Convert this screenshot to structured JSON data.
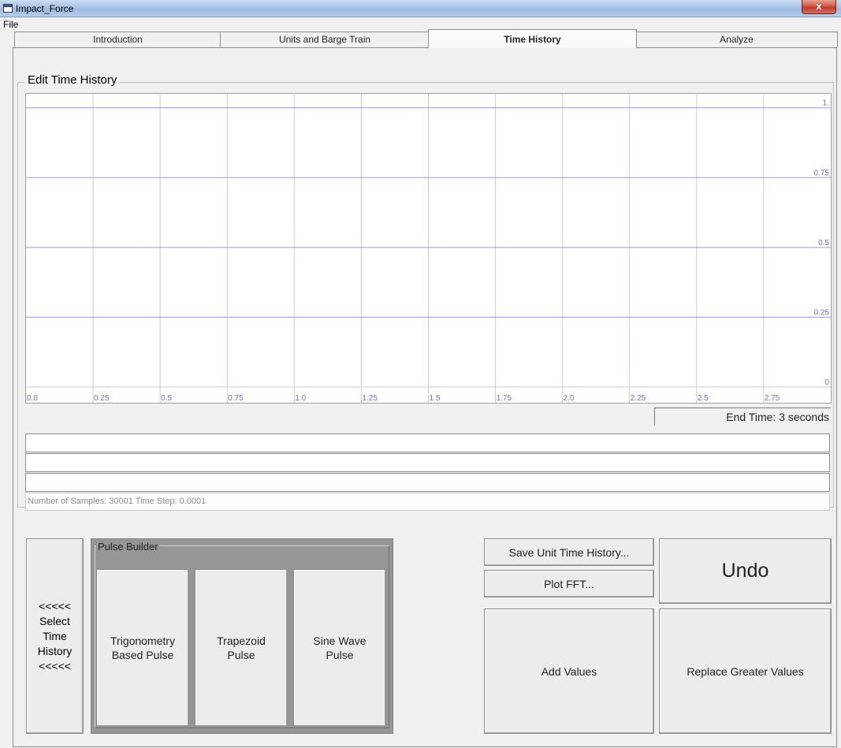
{
  "window": {
    "title": "Impact_Force",
    "close_glyph": "x",
    "app_icon": "window-icon"
  },
  "menu": {
    "file": "File"
  },
  "tabs": [
    {
      "label": "Introduction",
      "active": false
    },
    {
      "label": "Units and Barge Train",
      "active": false
    },
    {
      "label": "Time History",
      "active": true
    },
    {
      "label": "Analyze",
      "active": false
    }
  ],
  "edit_group": {
    "title": "Edit Time History"
  },
  "chart_data": {
    "type": "line",
    "series": [],
    "x_ticks": [
      "0.0",
      "0.25",
      "0.5",
      "0.75",
      "1.0",
      "1.25",
      "1.5",
      "1.75",
      "2.0",
      "2.25",
      "2.5",
      "2.75"
    ],
    "y_ticks": [
      "0",
      "0.25",
      "0.5",
      "0.75",
      "1."
    ],
    "xlim": [
      0,
      3
    ],
    "ylim": [
      0,
      1.05
    ],
    "grid": true,
    "grid_color": "#c8c8f0",
    "major_grid_color": "#9999dd"
  },
  "end_time": "End Time: 3 seconds",
  "text_rows": [
    "",
    "",
    ""
  ],
  "status": "Number of Samples: 30001   Time Step: 0.0001",
  "select_button": {
    "label_lines": [
      "<<<<<",
      "Select",
      "Time",
      "History",
      "<<<<<"
    ]
  },
  "pulse_builder": {
    "title": "Pulse Builder",
    "buttons": [
      {
        "lines": [
          "Trigonometry",
          "Based Pulse"
        ]
      },
      {
        "lines": [
          "Trapezoid",
          "Pulse"
        ]
      },
      {
        "lines": [
          "Sine Wave",
          "Pulse"
        ]
      }
    ]
  },
  "actions": {
    "save": "Save Unit Time History...",
    "fft": "Plot FFT...",
    "undo": "Undo",
    "add": "Add Values",
    "replace": "Replace Greater Values"
  }
}
